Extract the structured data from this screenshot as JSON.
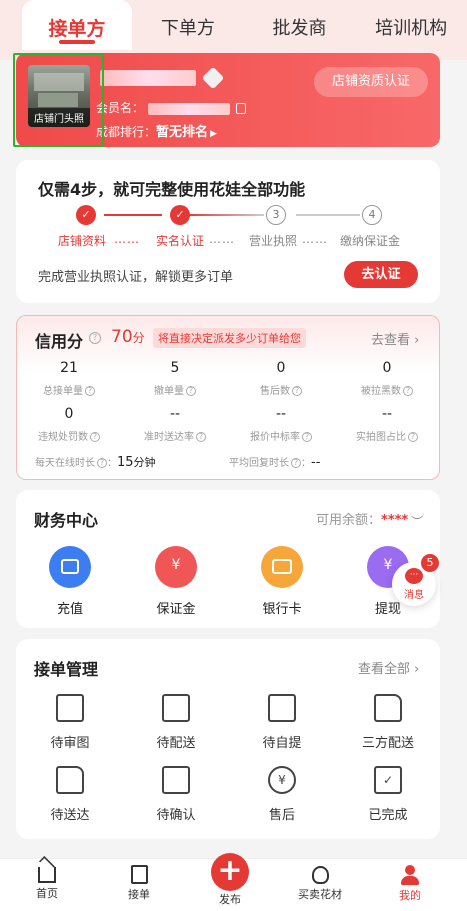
{
  "tabs": [
    {
      "label": "接单方",
      "active": true
    },
    {
      "label": "下单方",
      "active": false
    },
    {
      "label": "批发商",
      "active": false
    },
    {
      "label": "培训机构",
      "active": false
    }
  ],
  "shop": {
    "photo_label": "店铺门头照",
    "member_prefix": "会员名：",
    "rank_prefix": "成都排行：",
    "rank_value": "暂无排名",
    "cert_button": "店铺资质认证"
  },
  "steps": {
    "title": "仅需4步，就可完整使用花娃全部功能",
    "items": [
      {
        "label": "店铺资料",
        "done": true,
        "num": "1"
      },
      {
        "label": "实名认证",
        "done": true,
        "num": "2"
      },
      {
        "label": "营业执照",
        "done": false,
        "num": "3"
      },
      {
        "label": "缴纳保证金",
        "done": false,
        "num": "4"
      }
    ],
    "hint": "完成营业执照认证，解锁更多订单",
    "action": "去认证"
  },
  "credit": {
    "title": "信用分",
    "score": "70",
    "score_unit": "分",
    "tip": "将直接决定派发多少订单给您",
    "link": "去查看",
    "metrics": [
      {
        "value": "21",
        "label": "总接单量"
      },
      {
        "value": "5",
        "label": "撤单量"
      },
      {
        "value": "0",
        "label": "售后数"
      },
      {
        "value": "0",
        "label": "被拉黑数"
      },
      {
        "value": "0",
        "label": "违规处罚数"
      },
      {
        "value": "--",
        "label": "准时送达率"
      },
      {
        "value": "--",
        "label": "报价中标率"
      },
      {
        "value": "--",
        "label": "实拍图占比"
      }
    ],
    "online_label": "每天在线时长",
    "online_value": "15",
    "online_unit": "分钟",
    "reply_label": "平均回复时长",
    "reply_value": "--"
  },
  "finance": {
    "title": "财务中心",
    "balance_label": "可用余额：",
    "balance_value": "****",
    "items": [
      {
        "label": "充值",
        "icon": "wallet-icon",
        "color": "#3d7df2"
      },
      {
        "label": "保证金",
        "icon": "yuan-hexagon-icon",
        "color": "#f05656"
      },
      {
        "label": "银行卡",
        "icon": "bank-card-icon",
        "color": "#f7a63a"
      },
      {
        "label": "提现",
        "icon": "withdraw-icon",
        "color": "#9b6bf0"
      }
    ],
    "message_badge": "5",
    "message_label": "消息"
  },
  "orders": {
    "title": "接单管理",
    "view_all": "查看全部",
    "items": [
      {
        "label": "待审图",
        "icon": "image-review-icon"
      },
      {
        "label": "待配送",
        "icon": "package-icon"
      },
      {
        "label": "待自提",
        "icon": "box-icon"
      },
      {
        "label": "三方配送",
        "icon": "truck-icon"
      },
      {
        "label": "待送达",
        "icon": "delivery-truck-icon"
      },
      {
        "label": "待确认",
        "icon": "confirm-doc-icon"
      },
      {
        "label": "售后",
        "icon": "refund-icon"
      },
      {
        "label": "已完成",
        "icon": "done-clipboard-icon"
      }
    ]
  },
  "bottom_nav": [
    {
      "label": "首页",
      "icon": "home-icon",
      "active": false
    },
    {
      "label": "接单",
      "icon": "receive-order-icon",
      "active": false
    },
    {
      "label": "发布",
      "icon": "plus-icon",
      "active": false
    },
    {
      "label": "买卖花材",
      "icon": "flower-icon",
      "active": false
    },
    {
      "label": "我的",
      "icon": "user-icon",
      "active": true
    }
  ],
  "colors": {
    "accent": "#e53935",
    "green_highlight": "#2bb52f"
  }
}
